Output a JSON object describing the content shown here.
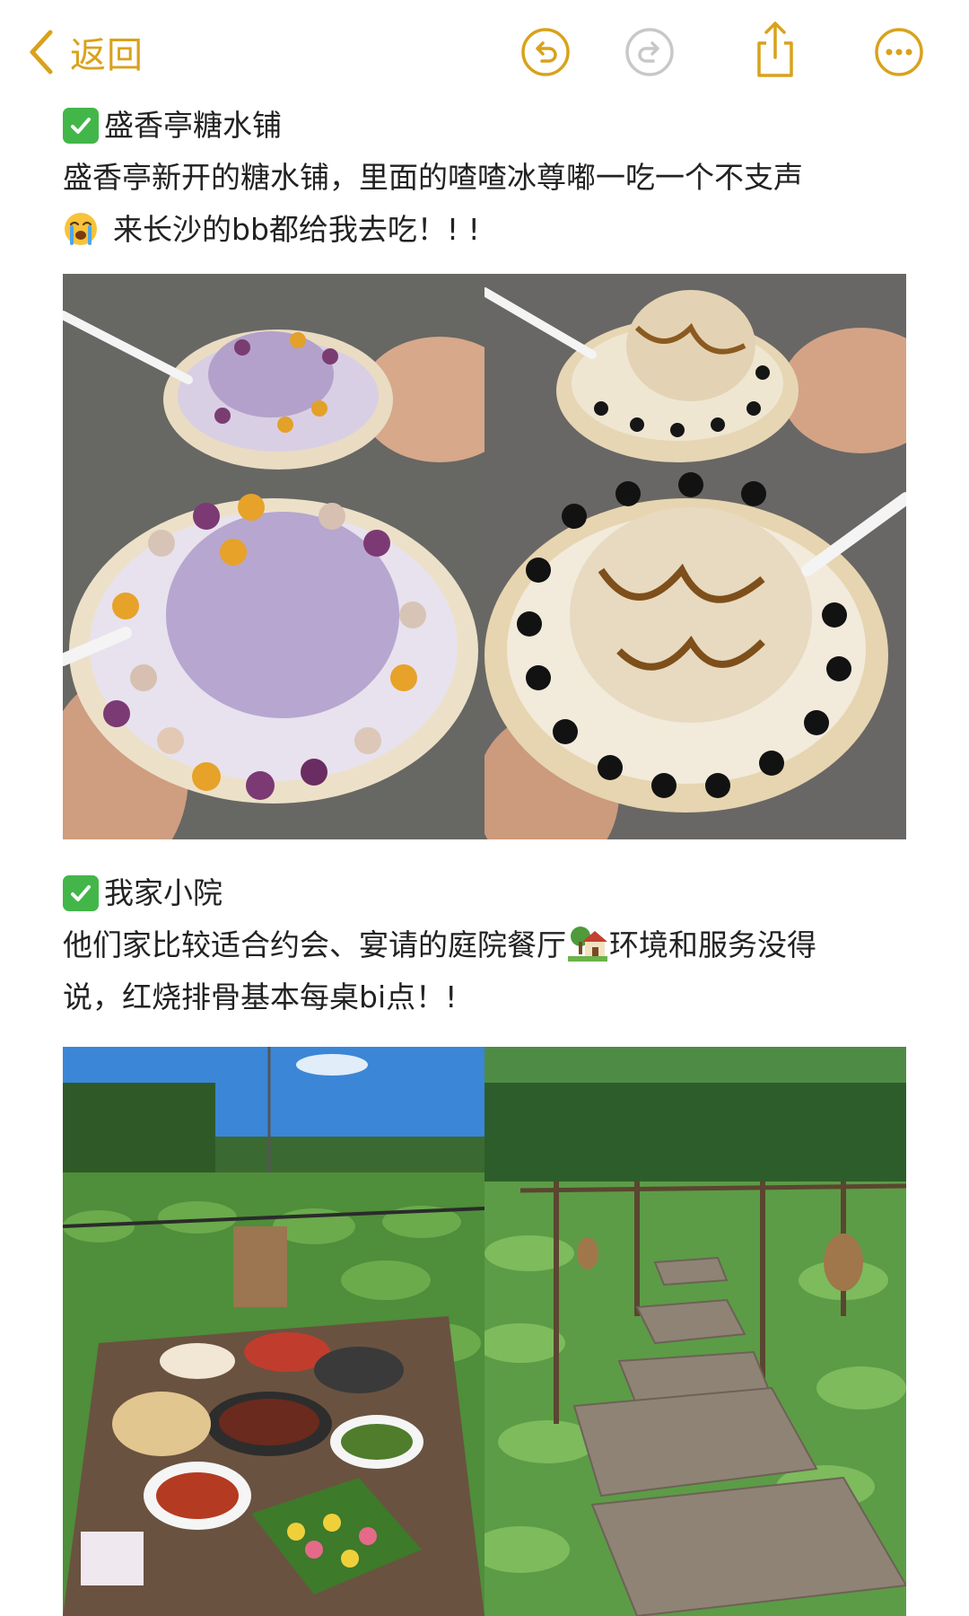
{
  "nav": {
    "back_label": "返回",
    "icons": [
      "chevron-left-icon",
      "undo-icon",
      "redo-icon",
      "share-icon",
      "more-icon"
    ],
    "accent_color": "#d9a21b",
    "disabled_color": "#c8c8c8"
  },
  "note": {
    "section1": {
      "title": "盛香亭糖水铺",
      "line1": "盛香亭新开的糖水铺，里面的喳喳冰尊嘟一吃一个不支声",
      "line2": "来长沙的bb都给我去吃！! !"
    },
    "section2": {
      "title": "我家小院",
      "line1_a": "他们家比较适合约会、宴请的庭院餐厅",
      "line1_b": "环境和服务没得",
      "line2": "说，红烧排骨基本每桌bi点！!"
    },
    "emoji": [
      "check-mark-emoji",
      "loudly-crying-face-emoji",
      "house-with-garden-emoji"
    ]
  },
  "images": [
    {
      "name": "photo-taro-shaved-ice"
    },
    {
      "name": "photo-brown-sugar-shaved-ice"
    },
    {
      "name": "photo-courtyard-dining-table"
    },
    {
      "name": "photo-lotus-pond-boardwalk"
    }
  ]
}
